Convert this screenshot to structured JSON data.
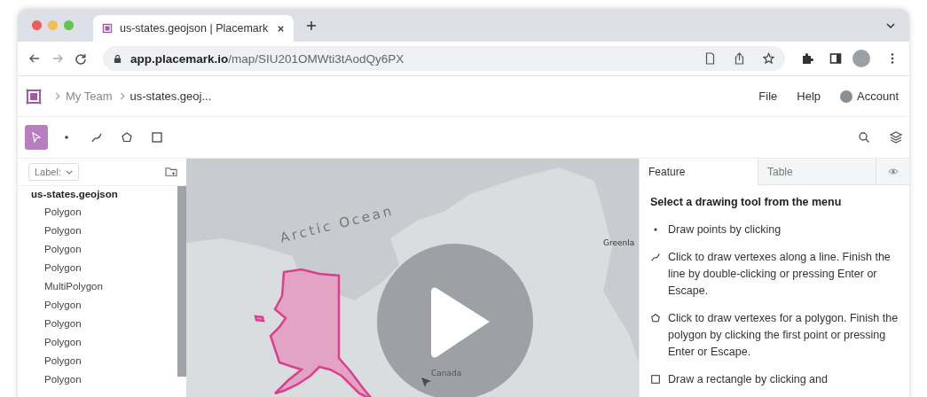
{
  "browser": {
    "tab_title": "us-states.geojson | Placemark",
    "url_host": "app.placemark.io",
    "url_path": "/map/SIU201OMWti3tAodQy6PX"
  },
  "header": {
    "breadcrumbs": [
      "My Team",
      "us-states.geoj..."
    ],
    "menu": [
      "File",
      "Help"
    ],
    "account": "Account"
  },
  "tools": [
    {
      "kind": "select",
      "selected": true
    },
    {
      "kind": "point",
      "selected": false
    },
    {
      "kind": "line",
      "selected": false
    },
    {
      "kind": "polygon",
      "selected": false
    },
    {
      "kind": "rectangle",
      "selected": false
    }
  ],
  "sidebar": {
    "label_filter": "Label:",
    "root": "us-states.geojson",
    "items": [
      "Polygon",
      "Polygon",
      "Polygon",
      "Polygon",
      "MultiPolygon",
      "Polygon",
      "Polygon",
      "Polygon",
      "Polygon",
      "Polygon"
    ]
  },
  "map": {
    "labels": [
      "Arctic Ocean",
      "Greenla",
      "Canada"
    ]
  },
  "panel": {
    "tabs": [
      {
        "label": "Feature",
        "selected": true
      },
      {
        "label": "Table",
        "selected": false
      }
    ],
    "heading": "Select a drawing tool from the menu",
    "instructions": [
      {
        "kind": "point",
        "text": "Draw points by clicking"
      },
      {
        "kind": "line",
        "text": "Click to draw vertexes along a line. Finish the line by double-clicking or pressing Enter or Escape."
      },
      {
        "kind": "polygon",
        "text": "Click to draw vertexes for a polygon. Finish the polygon by clicking the first point or pressing Enter or Escape."
      },
      {
        "kind": "rectangle",
        "text": "Draw a rectangle by clicking and"
      }
    ]
  }
}
